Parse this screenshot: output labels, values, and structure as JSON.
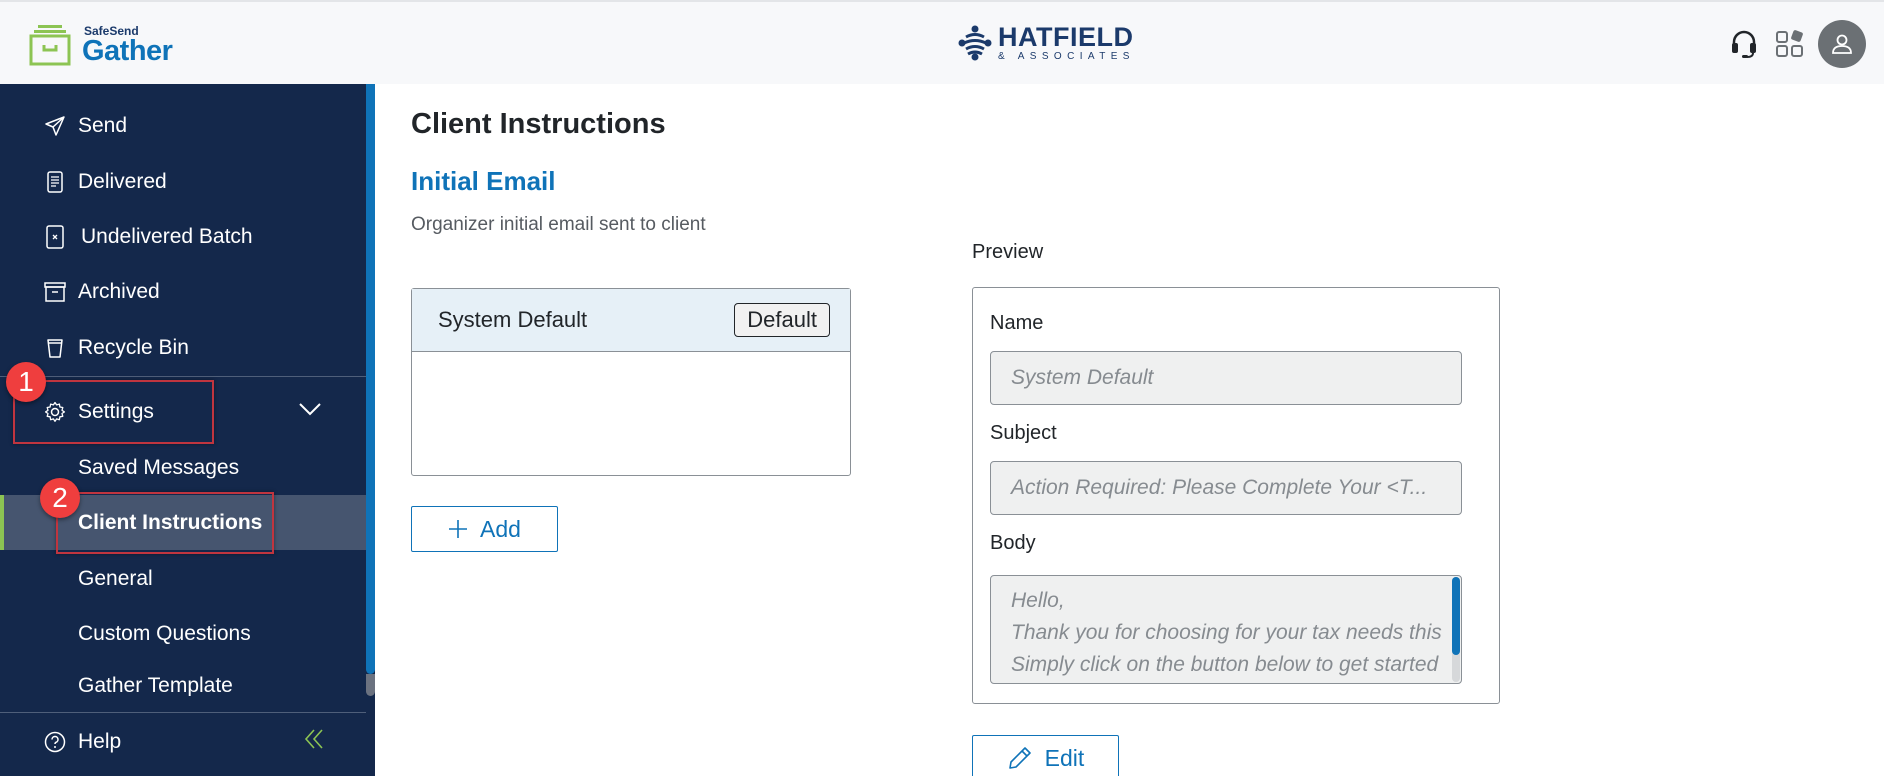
{
  "header": {
    "brand_top": "SafeSend",
    "brand_bottom": "Gather",
    "firm_name": "HATFIELD",
    "firm_sub": "& ASSOCIATES",
    "icons": [
      "headset-icon",
      "apps-grid-icon",
      "user-avatar-icon"
    ]
  },
  "sidebar": {
    "items": [
      {
        "label": "Send",
        "icon": "send-icon"
      },
      {
        "label": "Delivered",
        "icon": "document-icon"
      },
      {
        "label": "Undelivered Batch",
        "icon": "document-x-icon"
      },
      {
        "label": "Archived",
        "icon": "archive-icon"
      },
      {
        "label": "Recycle Bin",
        "icon": "bin-icon"
      }
    ],
    "settings": {
      "label": "Settings",
      "icon": "gear-icon",
      "expanded": true
    },
    "sub_items": [
      {
        "label": "Saved Messages",
        "active": false
      },
      {
        "label": "Client Instructions",
        "active": true
      },
      {
        "label": "General",
        "active": false
      },
      {
        "label": "Custom Questions",
        "active": false
      },
      {
        "label": "Gather Template",
        "active": false
      }
    ],
    "help": {
      "label": "Help",
      "icon": "help-icon"
    },
    "collapse_icon": "double-chevron-left-icon"
  },
  "annotations": [
    {
      "number": "1",
      "target": "Settings"
    },
    {
      "number": "2",
      "target": "Client Instructions"
    }
  ],
  "main": {
    "page_title": "Client Instructions",
    "section_title": "Initial Email",
    "section_desc": "Organizer initial email sent to client",
    "messages": [
      {
        "name": "System Default",
        "badge": "Default",
        "selected": true
      }
    ],
    "add_label": "Add",
    "preview": {
      "label": "Preview",
      "name_label": "Name",
      "name_value": "System Default",
      "subject_label": "Subject",
      "subject_value": "Action Required: Please Complete Your <T...",
      "body_label": "Body",
      "body_lines": [
        "Hello,",
        "Thank you for choosing for your tax needs this",
        "Simply click on the button below to get started"
      ]
    },
    "edit_label": "Edit"
  },
  "colors": {
    "sidebar_bg": "#14284b",
    "accent_blue": "#0f73b8",
    "active_green": "#8cc453",
    "annotation_red": "#ef3e3e"
  }
}
